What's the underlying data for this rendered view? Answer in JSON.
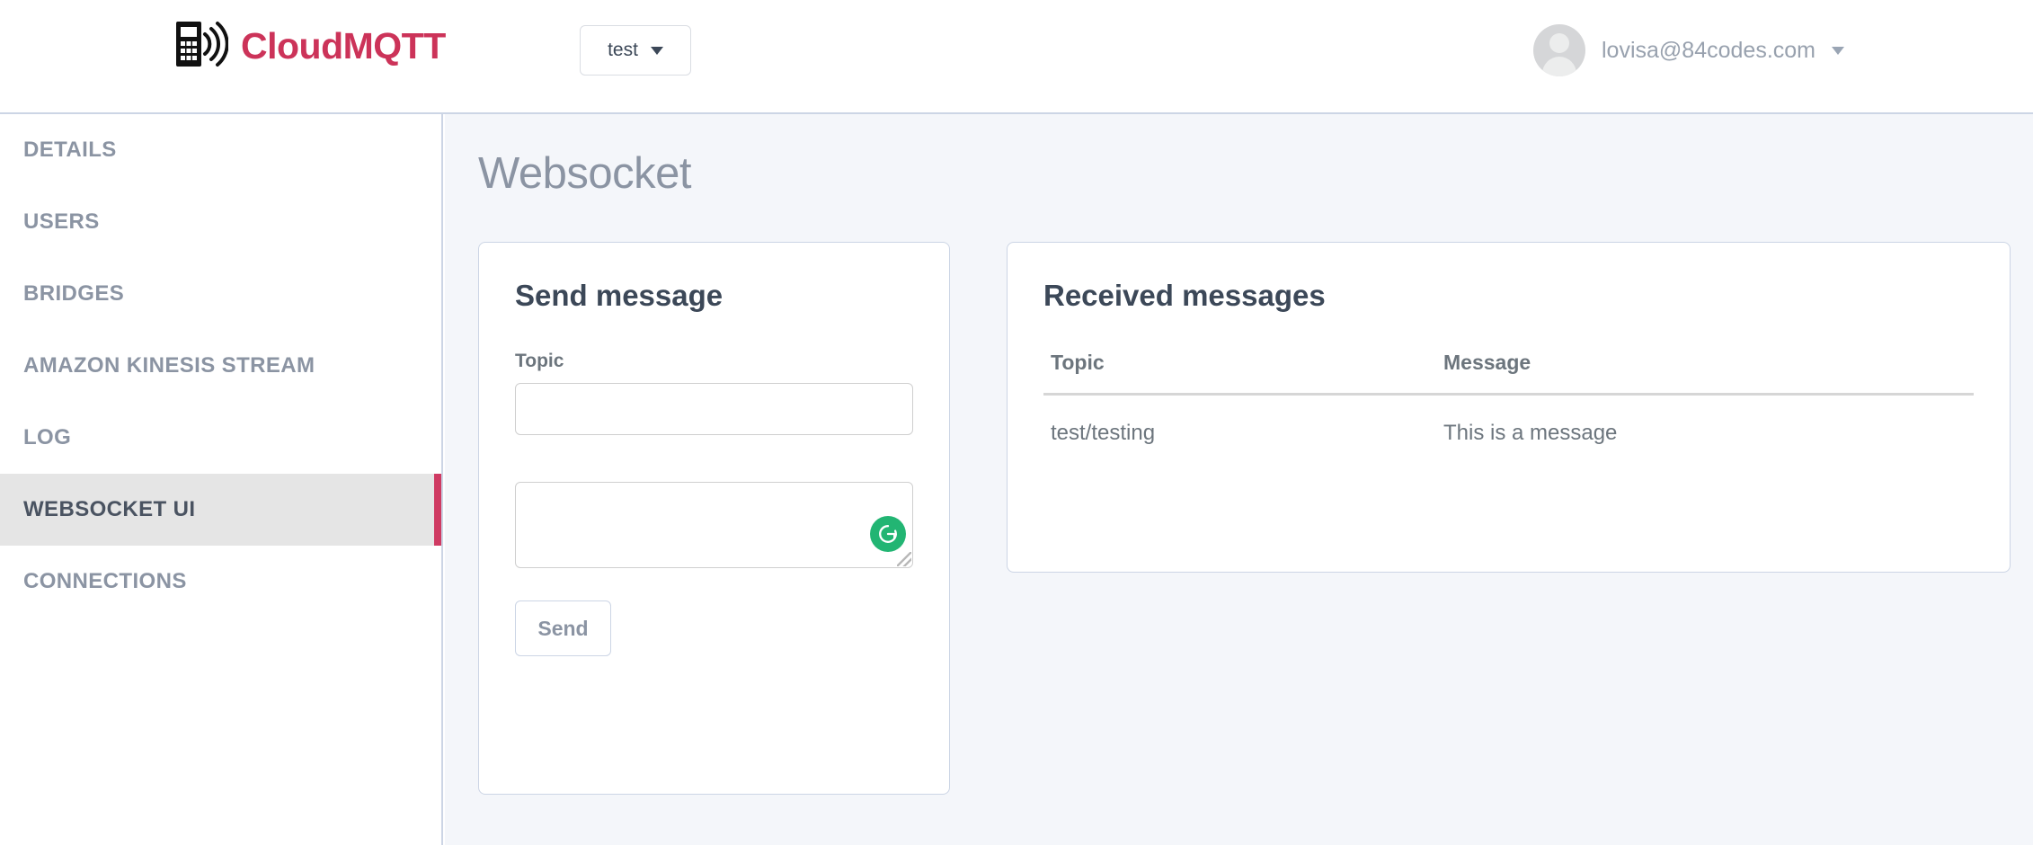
{
  "header": {
    "brand_name": "CloudMQTT",
    "brand_color": "#cc3359",
    "logo_icon": "mobile-signal-icon",
    "project_select": {
      "value": "test",
      "caret_icon": "chevron-down-icon"
    },
    "account": {
      "avatar_icon": "user-avatar-icon",
      "email": "lovisa@84codes.com",
      "caret_icon": "chevron-down-icon"
    }
  },
  "sidebar": {
    "items": [
      {
        "label": "DETAILS",
        "active": false
      },
      {
        "label": "USERS",
        "active": false
      },
      {
        "label": "BRIDGES",
        "active": false
      },
      {
        "label": "AMAZON KINESIS STREAM",
        "active": false
      },
      {
        "label": "LOG",
        "active": false
      },
      {
        "label": "WEBSOCKET UI",
        "active": true
      },
      {
        "label": "CONNECTIONS",
        "active": false
      }
    ],
    "active_accent_color": "#cf3a62",
    "active_bg_color": "#e5e5e5"
  },
  "main": {
    "page_title": "Websocket",
    "send_card": {
      "title": "Send message",
      "topic_label": "Topic",
      "topic_value": "",
      "topic_placeholder": "",
      "message_value": "",
      "message_placeholder": "",
      "grammarly_icon": "grammarly-icon",
      "grammarly_color": "#22b573",
      "resize_handle_icon": "resize-grip-icon",
      "send_label": "Send"
    },
    "received_card": {
      "title": "Received messages",
      "columns": [
        "Topic",
        "Message"
      ],
      "rows": [
        {
          "topic": "test/testing",
          "message": "This is a message"
        }
      ]
    }
  }
}
